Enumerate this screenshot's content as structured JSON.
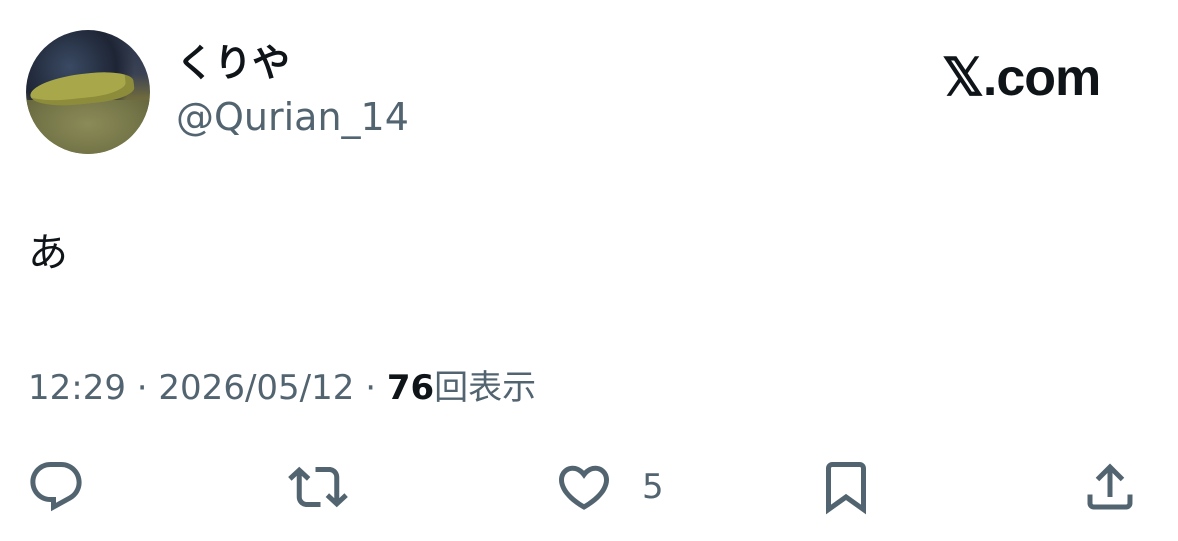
{
  "author": {
    "display_name": "くりや",
    "handle": "@Qurian_14"
  },
  "brand": "𝕏.com",
  "tweet": {
    "text": "あ",
    "time": "12:29",
    "separator": "·",
    "date": "2026/05/12",
    "views_count": "76",
    "views_label": "回表示"
  },
  "actions": {
    "reply_count": "",
    "retweet_count": "",
    "like_count": "5",
    "bookmark_count": "",
    "share_count": ""
  },
  "colors": {
    "text_primary": "#0f1419",
    "text_secondary": "#536471",
    "background": "#ffffff"
  },
  "icons": [
    "reply-icon",
    "retweet-icon",
    "like-heart-icon",
    "bookmark-icon",
    "share-icon"
  ]
}
